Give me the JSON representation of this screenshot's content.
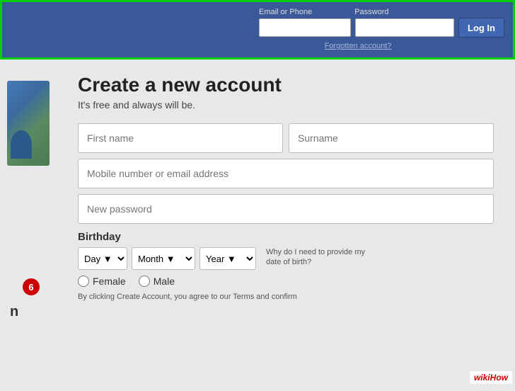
{
  "topbar": {
    "email_label": "Email or Phone",
    "password_label": "Password",
    "email_placeholder": "",
    "password_placeholder": "",
    "login_button": "Log In",
    "forgotten_link": "Forgotten account?"
  },
  "registration": {
    "title": "Create a new account",
    "subtitle": "It's free and always will be.",
    "first_name_placeholder": "First name",
    "surname_placeholder": "Surname",
    "mobile_placeholder": "Mobile number or email address",
    "password_placeholder": "New password",
    "birthday_label": "Birthday",
    "birthday_why": "Why do I need to provide my date of birth?",
    "day_label": "Day",
    "month_label": "Month",
    "year_label": "Year",
    "female_label": "Female",
    "male_label": "Male",
    "terms_text": "By clicking Create Account, you agree to our Terms and confirm"
  },
  "step_badge": "6",
  "sidebar_letter": "n",
  "wikihow": {
    "prefix": "wiki",
    "brand": "How"
  }
}
